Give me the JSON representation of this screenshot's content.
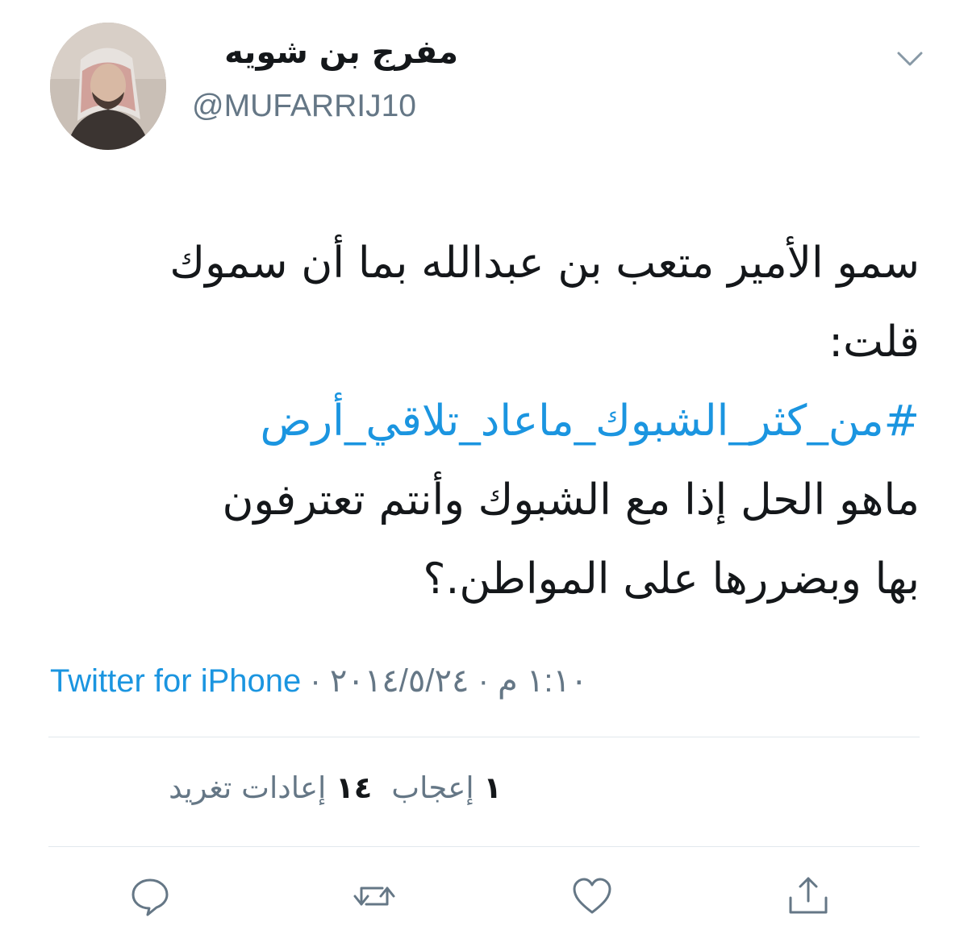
{
  "author": {
    "display_name": "مفرج بن شويه",
    "handle": "@MUFARRIJ10"
  },
  "tweet": {
    "line1": "سمو الأمير متعب بن عبدالله بما أن سموك",
    "line2": "قلت:",
    "hashtag": "#من_كثر_الشبوك_ماعاد_تلاقي_أرض",
    "line4": "ماهو الحل إذا مع الشبوك وأنتم تعترفون",
    "line5": "بها وبضررها على المواطن.؟"
  },
  "meta": {
    "source": "Twitter for iPhone",
    "separator": "·",
    "datetime": "١:١٠ م · ٢٠١٤/٥/٢٤"
  },
  "stats": {
    "likes_count": "١",
    "likes_label": "إعجاب",
    "retweets_count": "١٤",
    "retweets_label": "إعادات تغريد"
  },
  "icons": {
    "menu": "chevron-down-icon",
    "reply": "reply-icon",
    "retweet": "retweet-icon",
    "like": "heart-icon",
    "share": "share-icon"
  },
  "colors": {
    "link": "#1b95e0",
    "secondary_text": "#657786",
    "primary_text": "#14171a",
    "divider": "#e1e8ed"
  }
}
